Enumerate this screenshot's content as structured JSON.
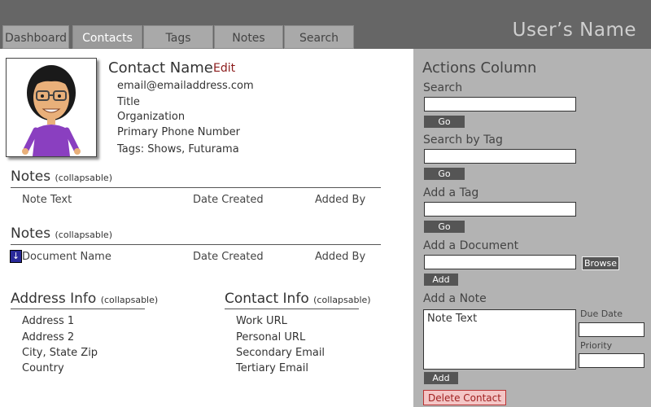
{
  "header": {
    "username": "User’s Name",
    "tabs": [
      {
        "label": "Dashboard"
      },
      {
        "label": "Contacts"
      },
      {
        "label": "Tags"
      },
      {
        "label": "Notes"
      },
      {
        "label": "Search"
      }
    ]
  },
  "contact": {
    "name": "Contact Name",
    "edit_label": "Edit",
    "email": "email@emailaddress.com",
    "title": "Title",
    "organization": "Organization",
    "phone": "Primary Phone Number",
    "tags": "Tags: Shows, Futurama"
  },
  "notes_section": {
    "title": "Notes",
    "note": "(collapsable)",
    "columns": [
      "Note Text",
      "Date Created",
      "Added By"
    ]
  },
  "documents_section": {
    "title": "Notes",
    "note": "(collapsable)",
    "columns": [
      "Document Name",
      "Date Created",
      "Added By"
    ]
  },
  "address_info": {
    "title": "Address Info",
    "note": "(collapsable)",
    "lines": [
      "Address 1",
      "Address 2",
      "City, State Zip",
      "Country"
    ]
  },
  "contact_info": {
    "title": "Contact Info",
    "note": "(collapsable)",
    "lines": [
      "Work URL",
      "Personal URL",
      "Secondary Email",
      "Tertiary Email"
    ]
  },
  "actions": {
    "title": "Actions Column",
    "search_label": "Search",
    "search_go": "Go",
    "search_tag_label": "Search by Tag",
    "search_tag_go": "Go",
    "add_tag_label": "Add a Tag",
    "add_tag_go": "Go",
    "add_document_label": "Add a Document",
    "browse_label": "Browse",
    "add_document_btn": "Add",
    "add_note_label": "Add a Note",
    "note_text_value": "Note Text",
    "due_date_label": "Due Date",
    "priority_label": "Priority",
    "add_note_btn": "Add",
    "delete_contact_label": "Delete Contact"
  }
}
